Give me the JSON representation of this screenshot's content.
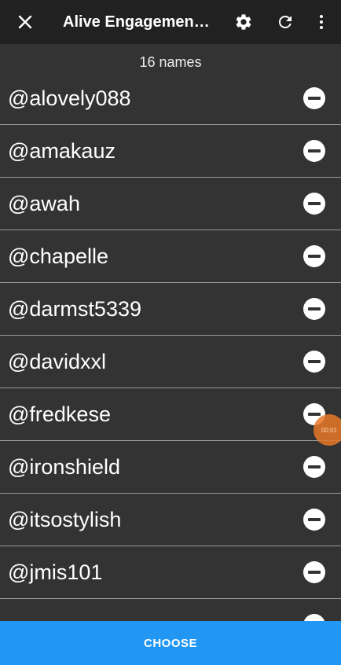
{
  "app_bar": {
    "title": "Alive Engagement Giveaway",
    "icons": [
      "close-icon",
      "settings-icon",
      "refresh-icon",
      "more-vert-icon"
    ]
  },
  "list": {
    "count_label": "16 names",
    "items": [
      {
        "name": "@alovely088"
      },
      {
        "name": "@amakauz"
      },
      {
        "name": "@awah"
      },
      {
        "name": "@chapelle"
      },
      {
        "name": "@darmst5339"
      },
      {
        "name": "@davidxxl"
      },
      {
        "name": "@fredkese"
      },
      {
        "name": "@ironshield"
      },
      {
        "name": "@itsostylish"
      },
      {
        "name": "@jmis101"
      }
    ]
  },
  "touch_indicator": {
    "label": "00:01"
  },
  "footer": {
    "choose_label": "CHOOSE"
  },
  "colors": {
    "app_bar": "#212121",
    "background": "#333333",
    "accent": "#2196f3"
  }
}
